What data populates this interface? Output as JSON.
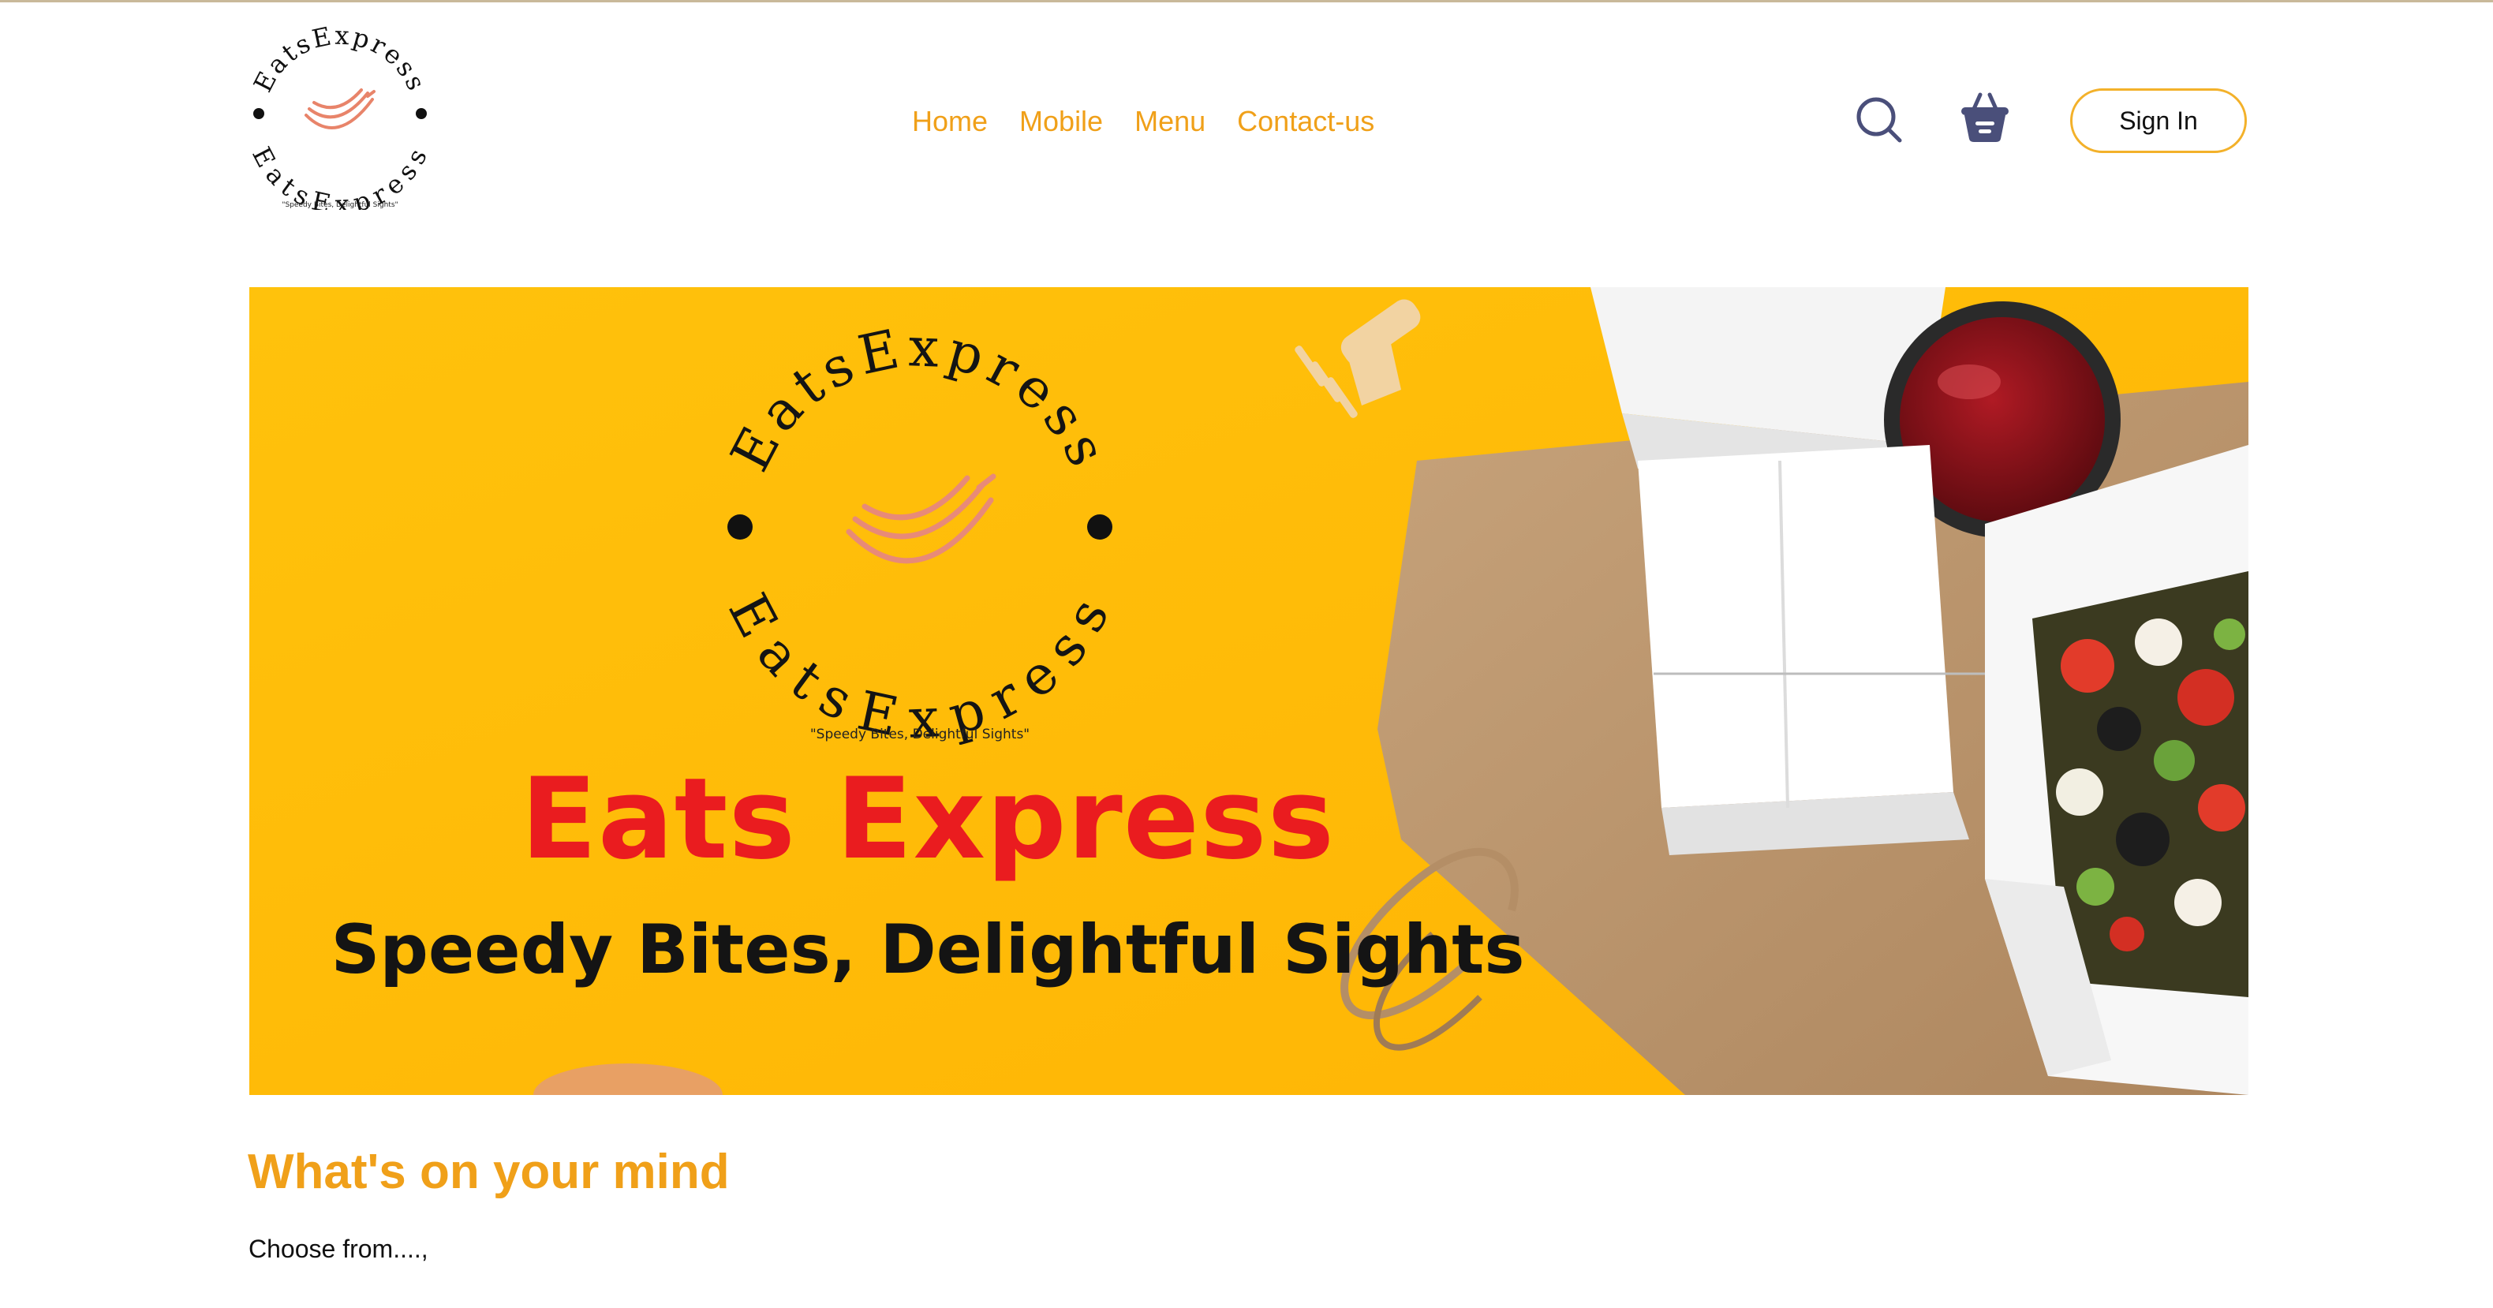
{
  "brand": {
    "name": "EatsExpress",
    "tagline": "\"Speedy Bites, Delightful Sights\""
  },
  "nav": {
    "items": [
      {
        "label": "Home"
      },
      {
        "label": "Mobile"
      },
      {
        "label": "Menu"
      },
      {
        "label": "Contact-us"
      }
    ]
  },
  "header": {
    "search_icon": "search-icon",
    "cart_icon": "basket-icon",
    "signin_label": "Sign In"
  },
  "banner": {
    "title": "Eats Express",
    "subtitle": "Speedy Bites, Delightful Sights"
  },
  "section": {
    "title": "What's on your mind",
    "subtitle": "Choose from....,"
  },
  "colors": {
    "accent": "#f0a019",
    "banner_bg": "#ffbf08",
    "banner_title": "#ea1c1f",
    "icon": "#4a4f7a"
  }
}
